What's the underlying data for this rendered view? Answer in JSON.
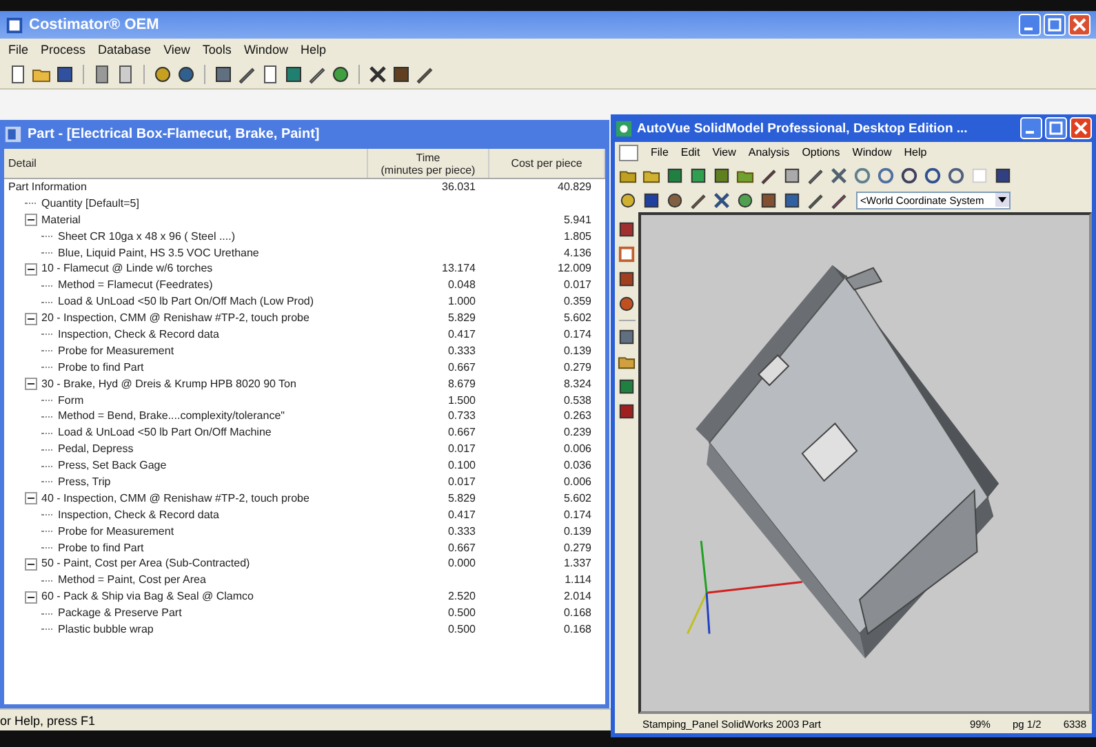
{
  "window": {
    "title": "Costimator® OEM"
  },
  "menu": [
    "File",
    "Process",
    "Database",
    "View",
    "Tools",
    "Window",
    "Help"
  ],
  "part_window": {
    "title": "Part - [Electrical Box-Flamecut, Brake, Paint]",
    "columns": [
      {
        "label": "Detail"
      },
      {
        "label": "Time",
        "sublabel": "(minutes per piece)"
      },
      {
        "label": "Cost per piece"
      }
    ],
    "rows": [
      {
        "label": "Part Information",
        "time": "36.031",
        "cost": "40.829",
        "children": [
          {
            "label": "Quantity [Default=5]"
          },
          {
            "label": "Material",
            "cost": "5.941",
            "expanded": true,
            "children": [
              {
                "label": "Sheet CR 10ga x 48 x  96 ( Steel ....)",
                "cost": "1.805"
              },
              {
                "label": "Blue, Liquid Paint, HS 3.5 VOC Urethane",
                "cost": "4.136"
              }
            ]
          },
          {
            "label": "10 - Flamecut @ Linde w/6 torches",
            "time": "13.174",
            "cost": "12.009",
            "expanded": true,
            "children": [
              {
                "label": "Method = Flamecut (Feedrates)",
                "time": "0.048",
                "cost": "0.017"
              },
              {
                "label": "Load & UnLoad <50 lb Part On/Off Mach (Low Prod)",
                "time": "1.000",
                "cost": "0.359"
              }
            ]
          },
          {
            "label": "20 - Inspection, CMM @ Renishaw #TP-2, touch probe",
            "time": "5.829",
            "cost": "5.602",
            "expanded": true,
            "children": [
              {
                "label": "Inspection, Check & Record data",
                "time": "0.417",
                "cost": "0.174"
              },
              {
                "label": "Probe for Measurement",
                "time": "0.333",
                "cost": "0.139"
              },
              {
                "label": "Probe to find Part",
                "time": "0.667",
                "cost": "0.279"
              }
            ]
          },
          {
            "label": "30 - Brake, Hyd @ Dreis & Krump HPB  8020 90 Ton",
            "time": "8.679",
            "cost": "8.324",
            "expanded": true,
            "children": [
              {
                "label": "Form",
                "time": "1.500",
                "cost": "0.538"
              },
              {
                "label": "Method = Bend, Brake....complexity/tolerance\"",
                "time": "0.733",
                "cost": "0.263"
              },
              {
                "label": "Load & UnLoad <50 lb Part On/Off Machine",
                "time": "0.667",
                "cost": "0.239"
              },
              {
                "label": "Pedal, Depress",
                "time": "0.017",
                "cost": "0.006"
              },
              {
                "label": "Press, Set Back Gage",
                "time": "0.100",
                "cost": "0.036"
              },
              {
                "label": "Press, Trip",
                "time": "0.017",
                "cost": "0.006"
              }
            ]
          },
          {
            "label": "40 - Inspection, CMM @ Renishaw #TP-2, touch probe",
            "time": "5.829",
            "cost": "5.602",
            "expanded": true,
            "children": [
              {
                "label": "Inspection, Check & Record data",
                "time": "0.417",
                "cost": "0.174"
              },
              {
                "label": "Probe for Measurement",
                "time": "0.333",
                "cost": "0.139"
              },
              {
                "label": "Probe to find Part",
                "time": "0.667",
                "cost": "0.279"
              }
            ]
          },
          {
            "label": "50 - Paint, Cost per Area (Sub-Contracted)",
            "time": "0.000",
            "cost": "1.337",
            "expanded": true,
            "children": [
              {
                "label": "Method = Paint, Cost per Area",
                "cost": "1.114"
              }
            ]
          },
          {
            "label": "60 - Pack & Ship via Bag & Seal @ Clamco",
            "time": "2.520",
            "cost": "2.014",
            "expanded": true,
            "children": [
              {
                "label": "Package & Preserve Part",
                "time": "0.500",
                "cost": "0.168"
              },
              {
                "label": "Plastic bubble wrap",
                "time": "0.500",
                "cost": "0.168"
              }
            ]
          }
        ]
      }
    ]
  },
  "status_bar": "or Help, press F1",
  "viewer": {
    "title": "AutoVue SolidModel Professional, Desktop Edition ...",
    "menu": [
      "File",
      "Edit",
      "View",
      "Analysis",
      "Options",
      "Window",
      "Help"
    ],
    "coordinate_system": "<World Coordinate System",
    "status": [
      "Stamping_Panel SolidWorks 2003 Part",
      "99%",
      "pg 1/2",
      "6338"
    ]
  }
}
